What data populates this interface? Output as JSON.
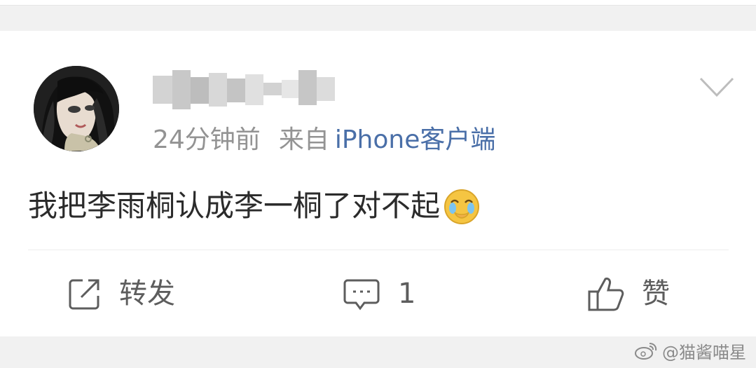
{
  "post": {
    "time_ago": "24分钟前",
    "source_prefix": "来自",
    "source_client": "iPhone客户端",
    "content_text": "我把李雨桐认成李一桐了对不起",
    "emoji": "crying-face-emoji"
  },
  "actions": {
    "repost_label": "转发",
    "comment_count": "1",
    "like_label": "赞"
  },
  "watermark": {
    "handle": "@猫酱喵星"
  },
  "icons": {
    "repost": "edit-share-icon",
    "comment": "comment-bubble-icon",
    "like": "thumbs-up-icon",
    "more": "chevron-down-icon"
  },
  "colors": {
    "accent_link": "#4a6fa8",
    "meta_text": "#939393",
    "body_text": "#2b2b2b",
    "action_text": "#5d5d5d"
  }
}
